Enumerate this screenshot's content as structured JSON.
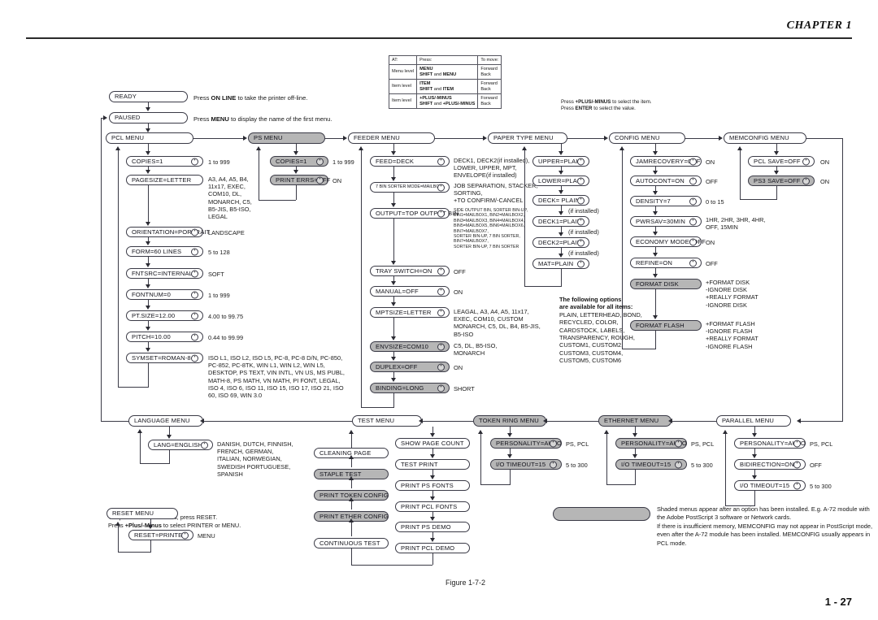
{
  "header": {
    "chapter": "CHAPTER  1"
  },
  "footer": {
    "figure": "Figure 1-7-2",
    "page": "1 - 27"
  },
  "key_table": {
    "headers": [
      "AT:",
      "Press:",
      "To move:"
    ],
    "rows": [
      {
        "at": "Menu level",
        "press": "MENU\nSHIFT and MENU",
        "move": "Forward\nBack"
      },
      {
        "at": "Item level",
        "press": "ITEM\nSHIFT and ITEM",
        "move": "Forward\nBack"
      },
      {
        "at": "Item level",
        "press": "+PLUS/-MINUS\nSHIFT and +PLUS/-MINUS",
        "move": "Forward\nBack"
      }
    ],
    "note": "Press +PLUS/-MINUS to select  the item.\nPress ENTER  to select the value."
  },
  "status": {
    "ready": "READY",
    "ready_note": "Press ON LINE to take the printer off-line.",
    "paused": "PAUSED",
    "paused_note": "Press MENU to display the name of the first menu."
  },
  "menus": {
    "pcl": {
      "title": "PCL MENU",
      "items": [
        {
          "label": "COPIES=1",
          "options": "1 to 999"
        },
        {
          "label": "PAGESIZE=LETTER",
          "options": "A3, A4, A5, B4,\n11x17, EXEC,\nCOM10, DL,\nMONARCH, C5,\nB5-JIS, B5-ISO,\nLEGAL"
        },
        {
          "label": "ORIENTATION=PORTRAIT",
          "options": "LANDSCAPE"
        },
        {
          "label": "FORM=60 LINES",
          "options": "5 to 128"
        },
        {
          "label": "FNTSRC=INTERNAL",
          "options": "SOFT"
        },
        {
          "label": "FONTNUM=0",
          "options": "1 to 999"
        },
        {
          "label": "PT.SIZE=12.00",
          "options": "4.00 to 99.75"
        },
        {
          "label": "PITCH=10.00",
          "options": "0.44 to 99.99"
        },
        {
          "label": "SYMSET=ROMAN-8",
          "options": "ISO L1, ISO L2, ISO L5, PC-8, PC-8 D/N, PC-850,\nPC-852,  PC-8TK,  WIN  L1,  WIN  L2,  WIN  L5,\nDESKTOP, PS TEXT, VIN INTL, VN US, MS PUBL,\nMATH-8, PS MATH, VN MATH, PI FONT, LEGAL,\nISO 4, ISO 6, ISO 11, ISO 15, ISO 17, ISO 21, ISO\n60, ISO 69, WIN 3.0"
        }
      ]
    },
    "ps": {
      "title": "PS MENU",
      "items": [
        {
          "label": "COPIES=1",
          "options": "1 to 999"
        },
        {
          "label": "PRINT ERRS=OFF",
          "options": "ON"
        }
      ]
    },
    "feeder": {
      "title": "FEEDER MENU",
      "items": [
        {
          "label": "FEED=DECK",
          "options": "DECK1, DECK2(if installed),\nLOWER, UPPER, MPT,\nENVELOPE(if installed)"
        },
        {
          "label": "7 BIN SORTER MODE=MAILBOX",
          "options": "JOB SEPARATION, STACKER,\nSORTING,\n+TO CONFIRM/-CANCEL"
        },
        {
          "label": "OUTPUT=TOP OUTPUT BIN",
          "options": "SIDE OUTPUT BIN,  SORTER BIN-UP,\nBIN1=MAILBOX1, BIN2=MAILBOX2,\nBIN3=MAILBOX3, BIN4=MAILBOX4,\nBIN5=MAILBOX5,  BIN6=MAILBOX6,\nBIN7=MAILBOX7,\nSORTER BIN-UP, 7 BIN SORTER,\nBIN7=MAILBOX7,\nSORTER BIN-UP, 7 BIN SORTER"
        },
        {
          "label": "TRAY SWITCH=ON",
          "options": "OFF"
        },
        {
          "label": "MANUAL=OFF",
          "options": "ON"
        },
        {
          "label": "MPTSIZE=LETTER",
          "options": "LEAGAL, A3, A4, A5, 11x17,\nEXEC, COM10, CUSTOM\nMONARCH, C5, DL, B4, B5-JIS,\nB5-ISO"
        },
        {
          "label": "ENVSIZE=COM10",
          "options": "C5, DL, B5-ISO,\nMONARCH"
        },
        {
          "label": "DUPLEX=OFF",
          "options": "ON"
        },
        {
          "label": "BINDING=LONG",
          "options": "SHORT"
        }
      ]
    },
    "paper_type": {
      "title": "PAPER TYPE MENU",
      "items": [
        {
          "label": "UPPER=PLAIN",
          "options": ""
        },
        {
          "label": "LOWER=PLAIN",
          "options": ""
        },
        {
          "label": "DECK= PLAIN",
          "options": "(if installed)"
        },
        {
          "label": "DECK1=PLAIN",
          "options": "(if installed)"
        },
        {
          "label": "DECK2=PLAIN",
          "options": "(if installed)"
        },
        {
          "label": "MAT=PLAIN",
          "options": ""
        }
      ],
      "note_head": "The following options\nare available for all items:",
      "note_body": "PLAIN, LETTERHEAD, BOND,\nRECYCLED, COLOR,\nCARDSTOCK, LABELS,\nTRANSPARENCY, ROUGH,\nCUSTOM1, CUSTOM2,\nCUSTOM3, CUSTOM4,\nCUSTOM5, CUSTOM6"
    },
    "config": {
      "title": "CONFIG MENU",
      "items": [
        {
          "label": "JAMRECOVERY=OFF",
          "options": "ON"
        },
        {
          "label": "AUTOCONT=ON",
          "options": "OFF"
        },
        {
          "label": "DENSITY=7",
          "options": "0 to 15"
        },
        {
          "label": "PWRSAV=30MIN",
          "options": "1HR, 2HR, 3HR, 4HR,\nOFF, 15MIN"
        },
        {
          "label": "ECONOMY MODE=OFF",
          "options": "ON"
        },
        {
          "label": "REFINE=ON",
          "options": "OFF"
        },
        {
          "label": "FORMAT DISK",
          "options": "+FORMAT DISK\n-IGNORE DISK\n+REALLY FORMAT\n-IGNORE DISK"
        },
        {
          "label": "FORMAT FLASH",
          "options": "+FORMAT FLASH\n-IGNORE FLASH\n+REALLY FORMAT\n-IGNORE FLASH"
        }
      ]
    },
    "memconfig": {
      "title": "MEMCONFIG MENU",
      "items": [
        {
          "label": "PCL SAVE=OFF",
          "options": "ON"
        },
        {
          "label": "PS3 SAVE=OFF",
          "options": "ON"
        }
      ]
    },
    "language": {
      "title": "LANGUAGE MENU",
      "items": [
        {
          "label": "LANG=ENGLISH",
          "options": "DANISH, DUTCH, FINNISH,\nFRENCH, GERMAN,\nITALIAN, NORWEGIAN,\nSWEDISH PORTUGUESE,\nSPANISH"
        }
      ]
    },
    "reset": {
      "title": "RESET MENU",
      "note": "To open the RESET menu, press RESET.\nPress +Plus/-Minus to select PRINTER or MENU.",
      "items": [
        {
          "label": "RESET=PRINTER",
          "options": "MENU"
        }
      ]
    },
    "test": {
      "title": "TEST MENU",
      "column_left": [
        {
          "label": "CLEANING PAGE"
        },
        {
          "label": "STAPLE TEST"
        },
        {
          "label": "PRINT TOKEN CONFIG"
        },
        {
          "label": "PRINT ETHER CONFIG"
        },
        {
          "label": "CONTINUOUS TEST"
        }
      ],
      "column_right": [
        {
          "label": "SHOW PAGE COUNT"
        },
        {
          "label": "TEST PRINT"
        },
        {
          "label": "PRINT PS FONTS"
        },
        {
          "label": "PRINT PCL FONTS"
        },
        {
          "label": "PRINT PS DEMO"
        },
        {
          "label": "PRINT PCL DEMO"
        }
      ]
    },
    "token_ring": {
      "title": "TOKEN RING MENU",
      "items": [
        {
          "label": "PERSONALITY=AUTO",
          "options": "PS, PCL"
        },
        {
          "label": "I/O TIMEOUT=15",
          "options": "5 to 300"
        }
      ]
    },
    "ethernet": {
      "title": "ETHERNET MENU",
      "items": [
        {
          "label": "PERSONALITY=AUTO",
          "options": "PS, PCL"
        },
        {
          "label": "I/O TIMEOUT=15",
          "options": "5 to 300"
        }
      ]
    },
    "parallel": {
      "title": "PARALLEL MENU",
      "items": [
        {
          "label": "PERSONALITY=AUTO",
          "options": "PS, PCL"
        },
        {
          "label": "BIDIRECTION=ON",
          "options": "OFF"
        },
        {
          "label": "I/O TIMEOUT=15",
          "options": "5 to 300"
        }
      ]
    }
  },
  "legend": {
    "text": "Shaded menus appear after an option has been installed. E.g. A-72 module with\nthe Adobe PostScript 3 software or Network cards.\nIf there is insufficient memory, MEMCONFIG may not appear in PostScript mode,\neven after the A-72 module has been installed. MEMCONFIG usually appears in\nPCL mode."
  },
  "colors": {
    "shaded": "#b6b6b6",
    "line": "#3a3a46",
    "text": "#14141c"
  }
}
